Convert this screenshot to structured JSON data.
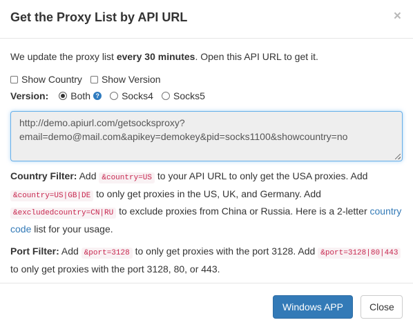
{
  "dialog": {
    "title": "Get the Proxy List by API URL",
    "close_symbol": "×"
  },
  "intro": {
    "text_before": "We update the proxy list ",
    "bold": "every 30 minutes",
    "text_after": ". Open this API URL to get it."
  },
  "options": {
    "show_country": {
      "label": "Show Country",
      "checked": false
    },
    "show_version": {
      "label": "Show Version",
      "checked": false
    },
    "version_label": "Version:",
    "versions": [
      {
        "label": "Both",
        "checked": true
      },
      {
        "label": "Socks4",
        "checked": false
      },
      {
        "label": "Socks5",
        "checked": false
      }
    ],
    "help_symbol": "?"
  },
  "api_url": {
    "line1": "http://demo.apiurl.com/getsocksproxy?",
    "line2": "email=demo@mail.com&apikey=demokey&pid=socks1100&showcountry=no"
  },
  "country_filter": {
    "label": "Country Filter:",
    "t1": " Add ",
    "c1": "&country=US",
    "t2": " to your API URL to only get the USA proxies. Add ",
    "c2": "&country=US|GB|DE",
    "t3": " to only get proxies in the US, UK, and Germany. Add ",
    "c3": "&excludedcountry=CN|RU",
    "t4": " to exclude proxies from China or Russia. Here is a 2-letter ",
    "link": "country code",
    "t5": " list for your usage."
  },
  "port_filter": {
    "label": "Port Filter:",
    "t1": " Add ",
    "c1": "&port=3128",
    "t2": " to only get proxies with the port 3128. Add ",
    "c2": "&port=3128|80|443",
    "t3": " to only get proxies with the port 3128, 80, or 443."
  },
  "footer": {
    "windows_app_label": "Windows APP",
    "close_label": "Close"
  },
  "colors": {
    "primary": "#337ab7",
    "code_text": "#c7254e",
    "code_bg": "#f9f2f4",
    "focus_border": "#66afe9"
  }
}
